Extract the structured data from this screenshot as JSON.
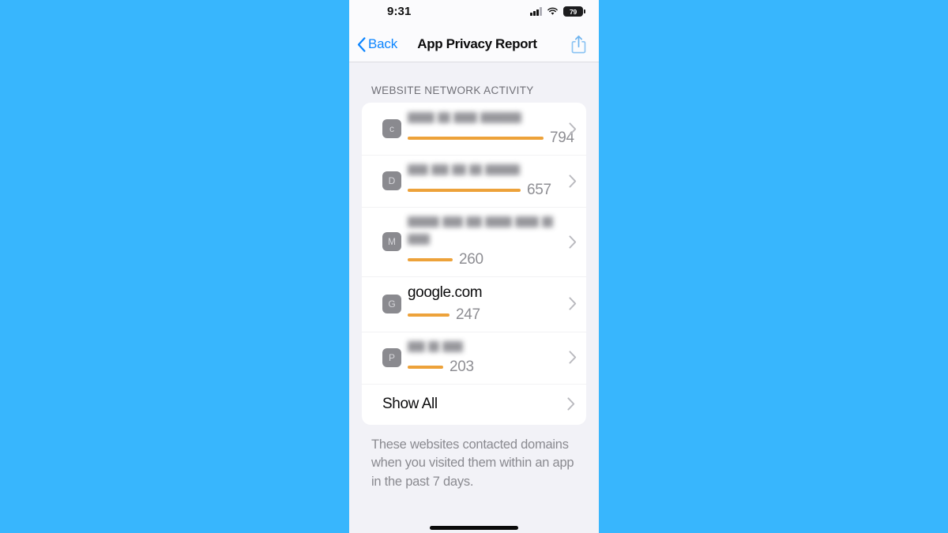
{
  "background_color": "#38b6fd",
  "status_bar": {
    "time": "9:31",
    "cellular_icon": "cellular-signal-icon",
    "wifi_icon": "wifi-icon",
    "battery_level": "79"
  },
  "nav_bar": {
    "back_label": "Back",
    "back_icon": "chevron-left-icon",
    "title": "App Privacy Report",
    "share_icon": "share-icon"
  },
  "section": {
    "header": "WEBSITE NETWORK ACTIVITY"
  },
  "rows": [
    {
      "avatar_letter": "c",
      "domain": "",
      "redacted": true,
      "redacted_lines": [
        [
          34,
          16,
          30,
          52
        ]
      ],
      "value": "794",
      "bar_pct": 100,
      "chevron_icon": "chevron-right-icon"
    },
    {
      "avatar_letter": "D",
      "domain": "",
      "redacted": true,
      "redacted_lines": [
        [
          26,
          22,
          18,
          16,
          44
        ]
      ],
      "value": "657",
      "bar_pct": 83,
      "chevron_icon": "chevron-right-icon"
    },
    {
      "avatar_letter": "M",
      "domain": "",
      "redacted": true,
      "redacted_lines": [
        [
          40,
          26,
          20,
          34,
          30,
          14
        ],
        [
          28
        ]
      ],
      "value": "260",
      "bar_pct": 33,
      "chevron_icon": "chevron-right-icon"
    },
    {
      "avatar_letter": "G",
      "domain": "google.com",
      "redacted": false,
      "value": "247",
      "bar_pct": 31,
      "chevron_icon": "chevron-right-icon"
    },
    {
      "avatar_letter": "P",
      "domain": "",
      "redacted": true,
      "redacted_lines": [
        [
          22,
          14,
          26
        ]
      ],
      "value": "203",
      "bar_pct": 26,
      "chevron_icon": "chevron-right-icon"
    }
  ],
  "show_all": {
    "label": "Show All",
    "chevron_icon": "chevron-right-icon"
  },
  "footer": {
    "note": "These websites contacted domains when you visited them within an app in the past 7 days."
  },
  "home_indicator": "home-indicator"
}
